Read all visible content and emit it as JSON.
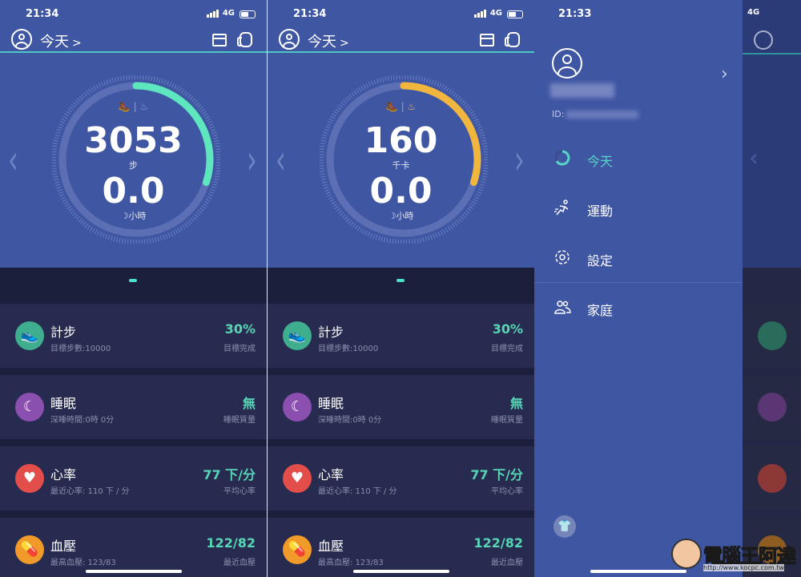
{
  "status": {
    "time_left": "21:34",
    "time_right": "21:33",
    "network": "4G"
  },
  "header": {
    "title": "今天",
    "chevron": ">"
  },
  "screens": [
    {
      "ring": {
        "value": "3053",
        "unit": "步",
        "sleep": "0.0",
        "sleep_unit": "小時",
        "progress": 0.3,
        "color": "#5ee6be"
      }
    },
    {
      "ring": {
        "value": "160",
        "unit": "千卡",
        "sleep": "0.0",
        "sleep_unit": "小時",
        "progress": 0.3,
        "color": "#f1b63e"
      }
    }
  ],
  "cards": [
    {
      "title": "計步",
      "sub": "目標步數:10000",
      "value": "30%",
      "value_sub": "目標完成",
      "color": "#3fae8e",
      "icon": "shoe-icon"
    },
    {
      "title": "睡眠",
      "sub": "深睡時間:0時 0分",
      "value": "無",
      "value_sub": "睡眠質量",
      "color": "#8b4fb0",
      "icon": "moon-icon"
    },
    {
      "title": "心率",
      "sub": "最近心率: 110 下 / 分",
      "value": "77 下/分",
      "value_sub": "平均心率",
      "color": "#e34d4a",
      "icon": "heart-icon"
    },
    {
      "title": "血壓",
      "sub": "最高血壓: 123/83",
      "value": "122/82",
      "value_sub": "最近血壓",
      "color": "#f09a2a",
      "icon": "pill-icon"
    }
  ],
  "drawer": {
    "id_label": "ID:",
    "menu": [
      {
        "label": "今天",
        "icon": "today-ring-icon"
      },
      {
        "label": "運動",
        "icon": "running-icon"
      },
      {
        "label": "設定",
        "icon": "gear-icon"
      },
      {
        "label": "家庭",
        "icon": "family-icon"
      }
    ]
  },
  "watermark": {
    "text": "電腦王阿達",
    "url": "http://www.kocpc.com.tw"
  }
}
